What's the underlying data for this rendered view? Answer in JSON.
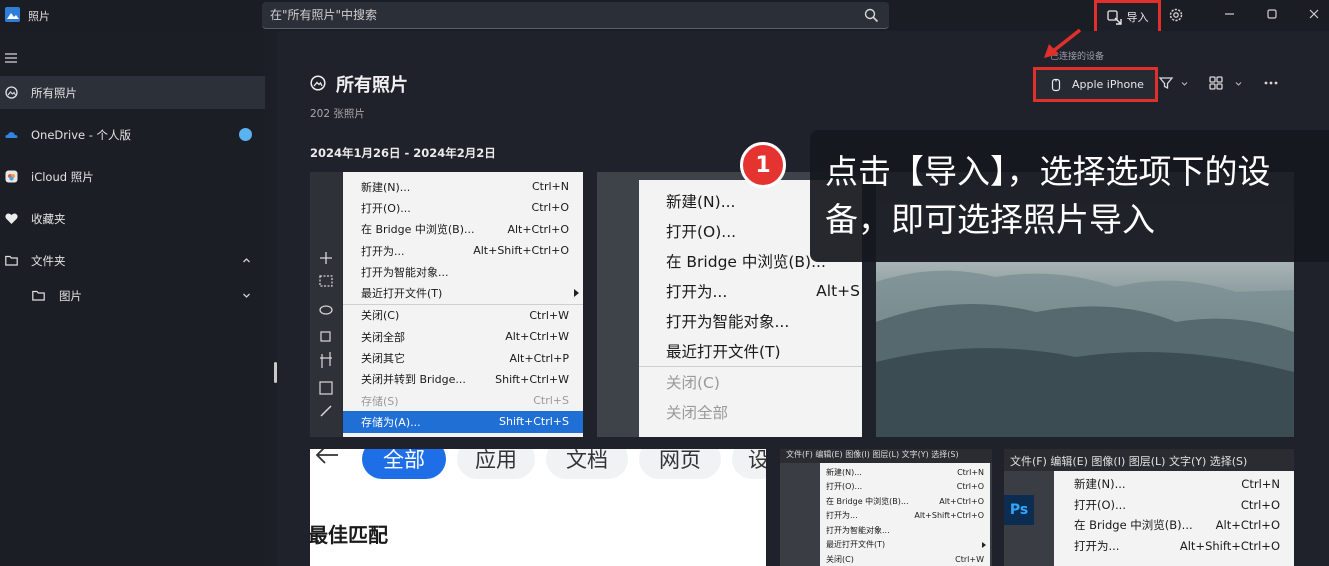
{
  "app": {
    "title": "照片"
  },
  "search": {
    "placeholder": "在\"所有照片\"中搜索"
  },
  "toolbar": {
    "import_label": "导入"
  },
  "sidebar": {
    "items": [
      {
        "label": "所有照片",
        "icon": "photos-icon"
      },
      {
        "label": "OneDrive - 个人版",
        "icon": "onedrive-icon"
      },
      {
        "label": "iCloud 照片",
        "icon": "icloud-icon"
      },
      {
        "label": "收藏夹",
        "icon": "heart-icon"
      },
      {
        "label": "文件夹",
        "icon": "folder-icon"
      },
      {
        "label": "图片",
        "icon": "folder-icon"
      }
    ]
  },
  "main": {
    "title": "所有照片",
    "count": "202 张照片",
    "date_range": "2024年1月26日 - 2024年2月2日",
    "device_hint": "已连接的设备",
    "device_name": "Apple iPhone"
  },
  "callout": {
    "step": "1",
    "text": "点击【导入】，选择选项下的设备，即可选择照片导入"
  },
  "tile1_menu": [
    {
      "label": "新建(N)...",
      "shortcut": "Ctrl+N"
    },
    {
      "label": "打开(O)...",
      "shortcut": "Ctrl+O"
    },
    {
      "label": "在 Bridge 中浏览(B)...",
      "shortcut": "Alt+Ctrl+O"
    },
    {
      "label": "打开为...",
      "shortcut": "Alt+Shift+Ctrl+O"
    },
    {
      "label": "打开为智能对象...",
      "shortcut": ""
    },
    {
      "label": "最近打开文件(T)",
      "shortcut": ""
    },
    {
      "label": "关闭(C)",
      "shortcut": "Ctrl+W"
    },
    {
      "label": "关闭全部",
      "shortcut": "Alt+Ctrl+W"
    },
    {
      "label": "关闭其它",
      "shortcut": "Alt+Ctrl+P"
    },
    {
      "label": "关闭并转到 Bridge...",
      "shortcut": "Shift+Ctrl+W"
    },
    {
      "label": "存储(S)",
      "shortcut": "Ctrl+S"
    },
    {
      "label": "存储为(A)...",
      "shortcut": "Shift+Ctrl+S"
    }
  ],
  "tile2_menu": [
    {
      "label": "新建(N)...",
      "shortcut": ""
    },
    {
      "label": "打开(O)...",
      "shortcut": ""
    },
    {
      "label": "在 Bridge 中浏览(B)...",
      "shortcut": ""
    },
    {
      "label": "打开为...",
      "shortcut": "Alt+S"
    },
    {
      "label": "打开为智能对象...",
      "shortcut": ""
    },
    {
      "label": "最近打开文件(T)",
      "shortcut": ""
    },
    {
      "label": "关闭(C)",
      "shortcut": ""
    },
    {
      "label": "关闭全部",
      "shortcut": ""
    }
  ],
  "tile4": {
    "chips": [
      "全部",
      "应用",
      "文档",
      "网页",
      "设"
    ],
    "best_match": "最佳匹配"
  },
  "tile5": {
    "menubar": "文件(F)  编辑(E)  图像(I)  图层(L)  文字(Y)  选择(S)",
    "menu": [
      {
        "label": "新建(N)...",
        "shortcut": "Ctrl+N"
      },
      {
        "label": "打开(O)...",
        "shortcut": "Ctrl+O"
      },
      {
        "label": "在 Bridge 中浏览(B)...",
        "shortcut": "Alt+Ctrl+O"
      },
      {
        "label": "打开为...",
        "shortcut": "Alt+Shift+Ctrl+O"
      },
      {
        "label": "打开为智能对象...",
        "shortcut": ""
      },
      {
        "label": "最近打开文件(T)",
        "shortcut": ""
      },
      {
        "label": "关闭(C)",
        "shortcut": "Ctrl+W"
      }
    ]
  },
  "tile6": {
    "menubar": "文件(F)  编辑(E)  图像(I)  图层(L)  文字(Y)  选择(S)",
    "logo": "Ps",
    "menu": [
      {
        "label": "新建(N)...",
        "shortcut": "Ctrl+N"
      },
      {
        "label": "打开(O)...",
        "shortcut": "Ctrl+O"
      },
      {
        "label": "在 Bridge 中浏览(B)...",
        "shortcut": "Alt+Ctrl+O"
      },
      {
        "label": "打开为...",
        "shortcut": "Alt+Shift+Ctrl+O"
      }
    ]
  },
  "colors": {
    "highlight_red": "#e0302b",
    "accent_blue": "#1e6ee8",
    "badge_red": "#e5342f"
  }
}
